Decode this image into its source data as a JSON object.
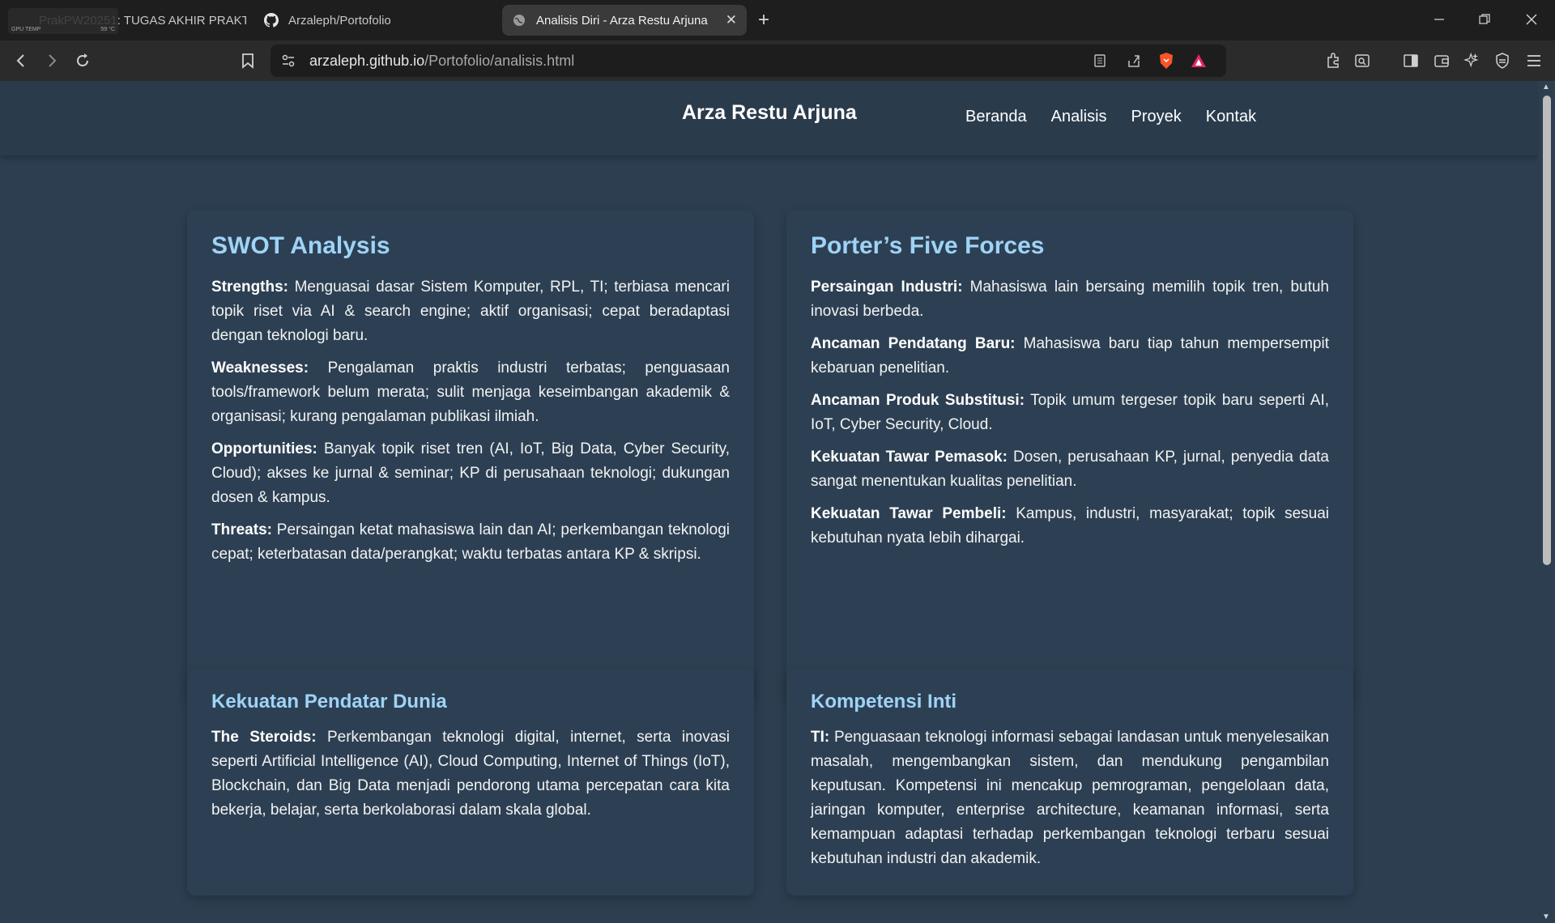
{
  "browser": {
    "gpu_widget": {
      "label": "GPU TEMP",
      "value": "59 °C"
    },
    "tabs": [
      {
        "title": "PrakPW20251: TUGAS AKHIR PRAKTI",
        "icon": "generic-page-icon"
      },
      {
        "title": "Arzaleph/Portofolio",
        "icon": "github-icon"
      },
      {
        "title": "Analisis Diri - Arza Restu Arjuna",
        "icon": "globe-icon"
      }
    ],
    "address": {
      "domain": "arzaleph.github.io",
      "path": "/Portofolio/analisis.html"
    }
  },
  "site": {
    "brand": "Arza Restu Arjuna",
    "nav": [
      "Beranda",
      "Analisis",
      "Proyek",
      "Kontak"
    ]
  },
  "swot": {
    "title": "SWOT Analysis",
    "items": [
      {
        "label": "Strengths:",
        "text": " Menguasai dasar Sistem Komputer, RPL, TI; terbiasa mencari topik riset via AI & search engine; aktif organisasi; cepat beradaptasi dengan teknologi baru."
      },
      {
        "label": "Weaknesses:",
        "text": " Pengalaman praktis industri terbatas; penguasaan tools/framework belum merata; sulit menjaga keseimbangan akademik & organisasi; kurang pengalaman publikasi ilmiah."
      },
      {
        "label": "Opportunities:",
        "text": " Banyak topik riset tren (AI, IoT, Big Data, Cyber Security, Cloud); akses ke jurnal & seminar; KP di perusahaan teknologi; dukungan dosen & kampus."
      },
      {
        "label": "Threats:",
        "text": " Persaingan ketat mahasiswa lain dan AI; perkembangan teknologi cepat; keterbatasan data/perangkat; waktu terbatas antara KP & skripsi."
      }
    ]
  },
  "porter": {
    "title": "Porter’s Five Forces",
    "items": [
      {
        "label": "Persaingan Industri:",
        "text": " Mahasiswa lain bersaing memilih topik tren, butuh inovasi berbeda."
      },
      {
        "label": "Ancaman Pendatang Baru:",
        "text": " Mahasiswa baru tiap tahun mempersempit kebaruan penelitian."
      },
      {
        "label": "Ancaman Produk Substitusi:",
        "text": " Topik umum tergeser topik baru seperti AI, IoT, Cyber Security, Cloud."
      },
      {
        "label": "Kekuatan Tawar Pemasok:",
        "text": " Dosen, perusahaan KP, jurnal, penyedia data sangat menentukan kualitas penelitian."
      },
      {
        "label": "Kekuatan Tawar Pembeli:",
        "text": " Kampus, industri, masyarakat; topik sesuai kebutuhan nyata lebih dihargai."
      }
    ]
  },
  "pendatar": {
    "title": "Kekuatan Pendatar Dunia",
    "items": [
      {
        "label": "The Steroids:",
        "text": " Perkembangan teknologi digital, internet, serta inovasi seperti Artificial Intelligence (AI), Cloud Computing, Internet of Things (IoT), Blockchain, dan Big Data menjadi pendorong utama percepatan cara kita bekerja, belajar, serta berkolaborasi dalam skala global."
      }
    ]
  },
  "kompetensi": {
    "title": "Kompetensi Inti",
    "items": [
      {
        "label": "TI:",
        "text": " Penguasaan teknologi informasi sebagai landasan untuk menyelesaikan masalah, mengembangkan sistem, dan mendukung pengambilan keputusan. Kompetensi ini mencakup pemrograman, pengelolaan data, jaringan komputer, enterprise architecture, keamanan informasi, serta kemampuan adaptasi terhadap perkembangan teknologi terbaru sesuai kebutuhan industri dan akademik."
      }
    ]
  },
  "colors": {
    "page_bg": "#2c3e50",
    "card_bg": "#2d4053",
    "heading": "#9fd3f7",
    "text": "#f2f2f2"
  }
}
